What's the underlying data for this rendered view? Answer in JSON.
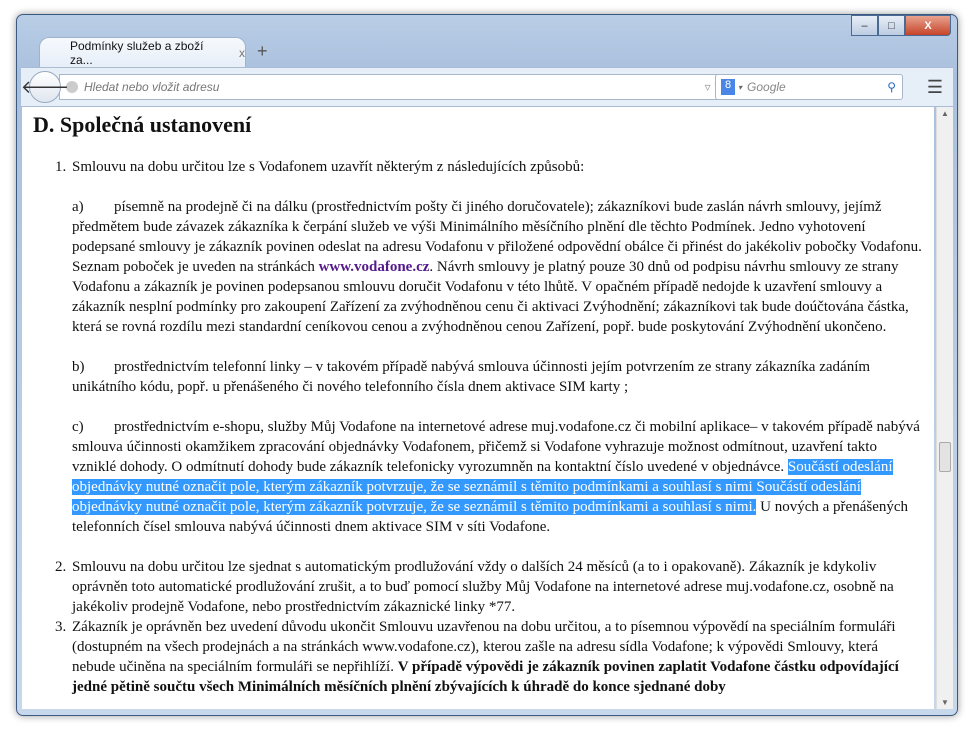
{
  "window": {
    "controls": {
      "minimize": "–",
      "maximize": "□",
      "close": "X"
    }
  },
  "tab": {
    "title": "Podmínky služeb a zboží za...",
    "close": "x",
    "new_tab": "+"
  },
  "nav": {
    "url_placeholder": "Hledat nebo vložit adresu",
    "search_engine": "8",
    "search_placeholder": "Google"
  },
  "page": {
    "heading": "D. Společná ustanovení",
    "item1_intro": "Smlouvu na dobu určitou lze s Vodafonem uzavřít některým z následujících způsobů:",
    "a_label": "a)",
    "a_text1": "písemně na prodejně či na dálku (prostřednictvím pošty či jiného doručovatele); zákazníkovi bude zaslán návrh smlouvy, jejímž předmětem bude závazek zákazníka k čerpání služeb ve výši Minimálního měsíčního plnění dle těchto Podmínek. Jedno vyhotovení podepsané smlouvy je zákazník povinen odeslat na adresu Vodafonu v přiložené odpovědní obálce či přinést do jakékoliv pobočky Vodafonu. Seznam poboček je uveden na stránkách ",
    "a_link": "www.vodafone.cz",
    "a_text2": ". Návrh smlouvy je platný pouze 30 dnů od podpisu návrhu smlouvy ze strany Vodafonu a zákazník je povinen podepsanou smlouvu doručit Vodafonu v této lhůtě. V opačném případě nedojde k uzavření smlouvy a zákazník nesplní podmínky pro zakoupení Zařízení za zvýhodněnou cenu či aktivaci Zvýhodnění; zákazníkovi tak bude doúčtována částka, která se rovná rozdílu mezi standardní ceníkovou cenou a zvýhodněnou cenou Zařízení, popř. bude poskytování Zvýhodnění ukončeno.",
    "b_label": "b)",
    "b_text": "prostřednictvím telefonní linky – v takovém případě nabývá smlouva účinnosti jejím potvrzením ze strany zákazníka zadáním unikátního kódu, popř. u přenášeného či nového telefonního čísla dnem aktivace SIM karty ;",
    "c_label": "c)",
    "c_text1": "prostřednictvím e-shopu, služby Můj Vodafone na internetové adrese muj.vodafone.cz či mobilní aplikace– v takovém případě nabývá smlouva účinnosti okamžikem zpracování objednávky Vodafonem, přičemž si Vodafone vyhrazuje možnost odmítnout, uzavření takto vzniklé dohody. O odmítnutí dohody bude zákazník telefonicky vyrozumněn na kontaktní číslo uvedené v objednávce. ",
    "c_selected": "Součástí odeslání objednávky nutné označit pole, kterým zákazník potvrzuje, že se seznámil s těmito podmínkami a souhlasí s nimi Součástí odeslání objednávky nutné označit pole, kterým zákazník potvrzuje, že se seznámil s těmito podmínkami a souhlasí s nimi.",
    "c_text2": " U nových a přenášených telefonních čísel smlouva nabývá účinnosti dnem aktivace SIM v síti Vodafone.",
    "item2": "Smlouvu na dobu určitou lze sjednat s automatickým prodlužování vždy o dalších 24 měsíců (a to i opakovaně). Zákazník je kdykoliv oprávněn toto automatické prodlužování zrušit, a to buď pomocí služby Můj Vodafone na internetové adrese muj.vodafone.cz,  osobně na jakékoliv prodejně Vodafone, nebo prostřednictvím zákaznické linky *77.",
    "item3_text": "Zákazník je oprávněn bez uvedení důvodu ukončit Smlouvu uzavřenou na dobu určitou, a to písemnou výpovědí na speciálním formuláři (dostupném na všech prodejnách a na stránkách www.vodafone.cz), kterou zašle na adresu sídla Vodafone; k výpovědi Smlouvy, která nebude učiněna na speciálním formuláři se nepřihlíží. ",
    "item3_bold": "V případě výpovědi je zákazník povinen zaplatit Vodafone částku odpovídající jedné pětině součtu všech Minimálních měsíčních plnění zbývajících k úhradě do konce sjednané doby",
    "numbers": [
      "1.",
      "2.",
      "3."
    ]
  }
}
